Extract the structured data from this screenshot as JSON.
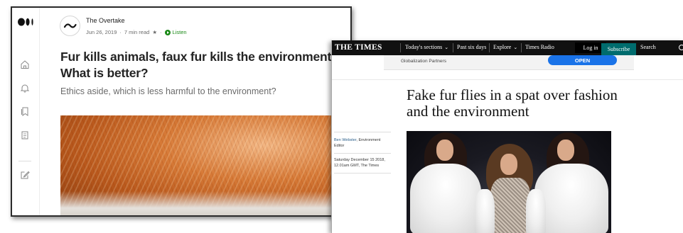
{
  "medium": {
    "logo_icon": "medium-logo-icon",
    "rail_icons": [
      "home-icon",
      "bell-icon",
      "bookmarks-icon",
      "document-icon",
      "write-icon"
    ],
    "author": "The Overtake",
    "date": "Jun 26, 2019",
    "separator": "·",
    "read_time": "7 min read",
    "star": "★",
    "listen_label": "Listen",
    "accent_color": "#1a8917",
    "title": "Fur kills animals, faux fur kills the environment. What is better?",
    "subtitle": "Ethics aside, which is less harmful to the environment?"
  },
  "times": {
    "logo": "THE TIMES",
    "nav": {
      "sections": "Today's sections",
      "past": "Past six days",
      "explore": "Explore",
      "radio": "Times Radio",
      "login": "Log in",
      "subscribe": "Subscribe",
      "search": "Search"
    },
    "subscribe_color": "#006c6e",
    "ad": {
      "text": "Globalization Partners",
      "button": "OPEN"
    },
    "headline": "Fake fur flies in a spat over fashion and the environment",
    "byline_author": "Ben Webster",
    "byline_role": ", Environment Editor",
    "dateline": "Saturday December 15 2018, 12.01am GMT, The Times"
  }
}
